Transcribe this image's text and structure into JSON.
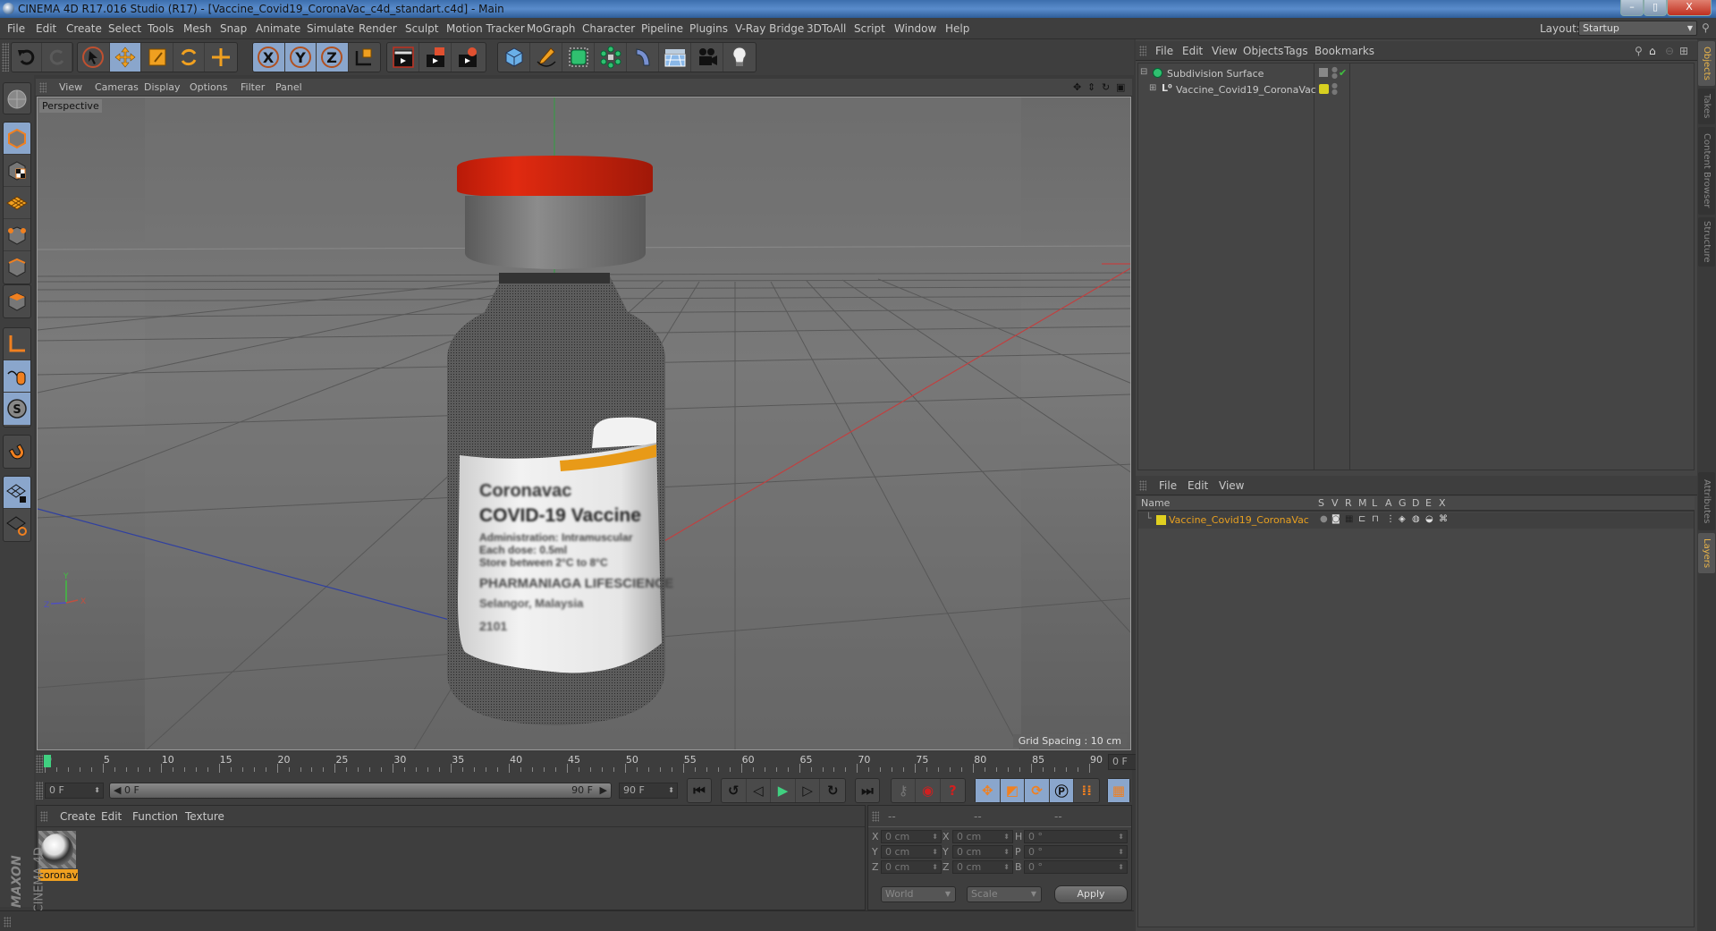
{
  "window": {
    "title": "CINEMA 4D R17.016 Studio (R17) - [Vaccine_Covid19_CoronaVac_c4d_standart.c4d] - Main",
    "controls": {
      "minimize": "–",
      "restore": "▯",
      "close": "X"
    }
  },
  "menubar": {
    "items": [
      "File",
      "Edit",
      "Create",
      "Select",
      "Tools",
      "Mesh",
      "Snap",
      "Animate",
      "Simulate",
      "Render",
      "Sculpt",
      "Motion Tracker",
      "MoGraph",
      "Character",
      "Pipeline",
      "Plugins",
      "V-Ray Bridge",
      "3DToAll",
      "Script",
      "Window",
      "Help"
    ],
    "layout_label": "Layout:",
    "layout_value": "Startup"
  },
  "toolbar": {
    "groups": [
      [
        "undo-icon",
        "redo-icon"
      ],
      [
        "live-selection-icon",
        "move-icon",
        "scale-icon",
        "rotate-icon",
        "transform-icon"
      ],
      [
        "x-axis-icon",
        "y-axis-icon",
        "z-axis-icon",
        "coordinate-system-icon"
      ],
      [
        "render-view-icon",
        "render-picture-viewer-icon",
        "render-settings-icon"
      ],
      [
        "cube-icon",
        "pen-icon",
        "subdivision-icon",
        "array-icon",
        "deformer-icon",
        "floor-icon",
        "camera-icon",
        "light-icon"
      ]
    ]
  },
  "left_tools": [
    "make-editable-icon",
    "model-mode-icon",
    "texture-mode-icon",
    "workplane-mode-icon",
    "points-mode-icon",
    "edges-mode-icon",
    "polygons-mode-icon",
    "axis-mode-icon",
    "tweak-mode-icon",
    "solo-icon",
    "snap-icon",
    "workplane-lock-icon",
    "workplane-sync-icon"
  ],
  "viewport": {
    "menu": [
      "View",
      "Cameras",
      "Display",
      "Options",
      "Filter",
      "Panel"
    ],
    "label": "Perspective",
    "grid_spacing": "Grid Spacing : 10 cm",
    "label_texts": {
      "brand": "Coronavac",
      "title": "COVID-19 Vaccine",
      "line1": "Administration: Intramuscular",
      "line2": "Each dose: 0.5ml",
      "line3": "Store between 2°C to 8°C",
      "maker": "PHARMANIAGA LIFESCIENCE",
      "loc": "Selangor, Malaysia",
      "lot": "2101"
    },
    "axis_labels": {
      "x": "X",
      "y": "Y",
      "z": "Z"
    }
  },
  "timeline": {
    "ticks": [
      "0",
      "5",
      "10",
      "15",
      "20",
      "25",
      "30",
      "35",
      "40",
      "45",
      "50",
      "55",
      "60",
      "65",
      "70",
      "75",
      "80",
      "85",
      "90"
    ],
    "current_frame": "0 F",
    "current_position": 0,
    "max_frame": 90
  },
  "transport": {
    "start_field": "0 F",
    "range_start": "0 F",
    "range_end": "90 F",
    "end_field": "90 F"
  },
  "material_panel": {
    "menu": [
      "Create",
      "Edit",
      "Function",
      "Texture"
    ],
    "materials": [
      {
        "name": "coronav"
      }
    ]
  },
  "coord_panel": {
    "headers": [
      "--",
      "--",
      "--"
    ],
    "rows": [
      {
        "a_label": "X",
        "a_val": "0 cm",
        "b_label": "X",
        "b_val": "0 cm",
        "c_label": "H",
        "c_val": "0 °"
      },
      {
        "a_label": "Y",
        "a_val": "0 cm",
        "b_label": "Y",
        "b_val": "0 cm",
        "c_label": "P",
        "c_val": "0 °"
      },
      {
        "a_label": "Z",
        "a_val": "0 cm",
        "b_label": "Z",
        "b_val": "0 cm",
        "c_label": "B",
        "c_val": "0 °"
      }
    ],
    "mode_select": "World",
    "type_select": "Scale",
    "apply_label": "Apply"
  },
  "object_manager": {
    "menu": [
      "File",
      "Edit",
      "View",
      "Objects",
      "Tags",
      "Bookmarks"
    ],
    "objects": [
      {
        "name": "Subdivision Surface",
        "icon": "subdivision-icon",
        "expanded": true
      },
      {
        "name": "Vaccine_Covid19_CoronaVac",
        "icon": "null-object-icon",
        "expanded": false,
        "color": "#d8d020"
      }
    ]
  },
  "layer_manager": {
    "menu": [
      "File",
      "Edit",
      "View"
    ],
    "columns": [
      "Name",
      "S",
      "V",
      "R",
      "M",
      "L",
      "A",
      "G",
      "D",
      "E",
      "X"
    ],
    "layers": [
      {
        "name": "Vaccine_Covid19_CoronaVac",
        "color": "#e0d020"
      }
    ]
  },
  "side_tabs": {
    "top": [
      "Objects",
      "Takes",
      "Content Browser",
      "Structure"
    ],
    "bottom": [
      "Attributes",
      "Layers"
    ]
  },
  "branding": {
    "maxon": "MAXON",
    "product": "CINEMA 4D"
  },
  "colors": {
    "accent_blue": "#8aa6cc",
    "orange": "#f0a020",
    "selected_text": "#e8a020"
  }
}
